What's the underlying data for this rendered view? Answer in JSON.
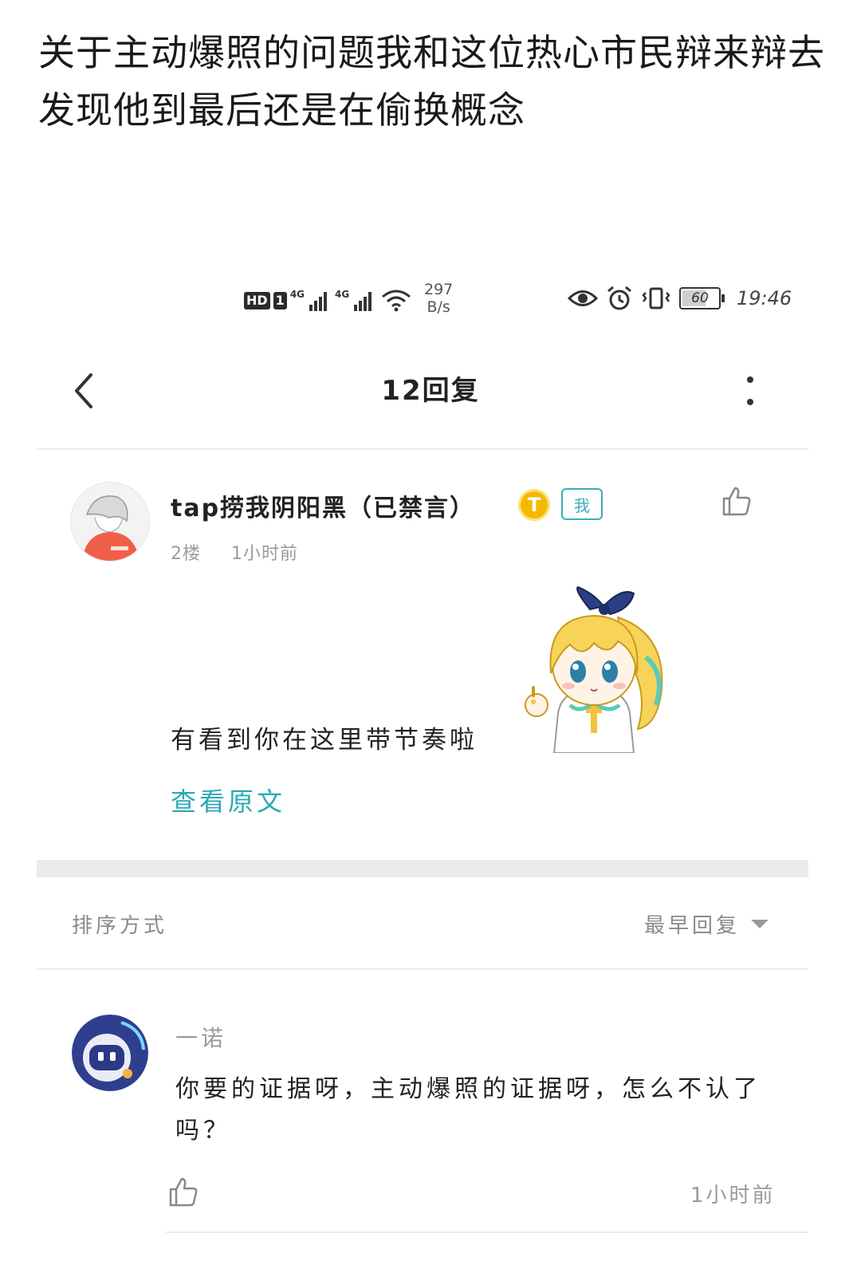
{
  "post_title": "关于主动爆照的问题我和这位热心市民辩来辩去发现他到最后还是在偷换概念",
  "status_bar": {
    "hd_label": "HD",
    "sim_label": "1",
    "net1": "4G",
    "net2": "4G",
    "speed_value": "297",
    "speed_unit": "B/s",
    "battery": "60",
    "time": "19:46"
  },
  "header": {
    "title": "12回复"
  },
  "post": {
    "username": "tap捞我阴阳黑（已禁言）",
    "level_badge": "T",
    "me_badge": "我",
    "floor": "2楼",
    "time": "1小时前",
    "content": "有看到你在这里带节奏啦",
    "view_original": "查看原文"
  },
  "sort": {
    "label": "排序方式",
    "value": "最早回复"
  },
  "reply": {
    "username": "一诺",
    "content": "你要的证据呀，主动爆照的证据呀，怎么不认了吗？",
    "time": "1小时前"
  },
  "colors": {
    "accent": "#2aa9b4",
    "muted": "#9a9a9a",
    "badge_gold": "#f5b800"
  }
}
